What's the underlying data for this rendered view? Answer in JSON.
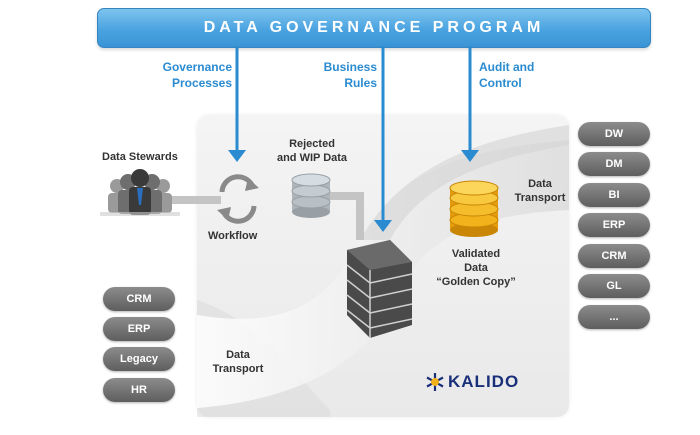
{
  "banner": {
    "title": "DATA GOVERNANCE PROGRAM"
  },
  "top_labels": [
    {
      "line1": "Governance",
      "line2": "Processes"
    },
    {
      "line1": "Business",
      "line2": "Rules"
    },
    {
      "line1": "Audit and",
      "line2": "Control"
    }
  ],
  "labels": {
    "data_stewards": "Data Stewards",
    "rejected_line1": "Rejected",
    "rejected_line2": "and WIP Data",
    "workflow": "Workflow",
    "transport_right_line1": "Data",
    "transport_right_line2": "Transport",
    "validated_line1": "Validated",
    "validated_line2": "Data",
    "validated_line3": "“Golden Copy”",
    "transport_bottom_line1": "Data",
    "transport_bottom_line2": "Transport"
  },
  "sources": [
    "CRM",
    "ERP",
    "Legacy",
    "HR"
  ],
  "targets": [
    "DW",
    "DM",
    "BI",
    "ERP",
    "CRM",
    "GL",
    "..."
  ],
  "brand": {
    "name": "KALIDO"
  },
  "colors": {
    "accent_blue": "#2a8bd0",
    "banner_blue": "#4aa3e0",
    "pill_gray": "#6e6e6e",
    "gold": "#f2b21b",
    "brand_navy": "#1a2f7a"
  },
  "icons": [
    "people-icon",
    "workflow-cycle-icon",
    "database-gray-icon",
    "firewall-icon",
    "database-gold-icon",
    "kalido-logo-icon"
  ]
}
